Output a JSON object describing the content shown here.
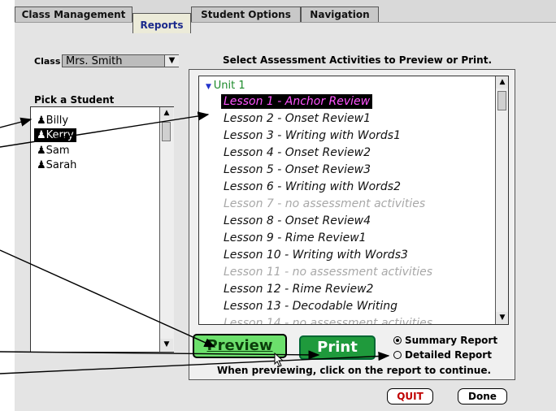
{
  "tabs": [
    {
      "label": "Class Management"
    },
    {
      "label": "Reports"
    },
    {
      "label": "Student Options"
    },
    {
      "label": "Navigation"
    }
  ],
  "class_selector": {
    "label": "Class",
    "value": "Mrs. Smith"
  },
  "student_list": {
    "heading": "Pick a Student",
    "students": [
      "Billy",
      "Kerry",
      "Sam",
      "Sarah"
    ],
    "selected": "Kerry"
  },
  "assessment": {
    "heading": "Select Assessment Activities to Preview or Print.",
    "unit_label": "Unit 1",
    "lessons": [
      {
        "label": "Lesson 1 - Anchor Review",
        "state": "selected"
      },
      {
        "label": "Lesson 2 - Onset Review1",
        "state": "normal"
      },
      {
        "label": "Lesson 3 - Writing with Words1",
        "state": "normal"
      },
      {
        "label": "Lesson 4 - Onset Review2",
        "state": "normal"
      },
      {
        "label": "Lesson 5 - Onset Review3",
        "state": "normal"
      },
      {
        "label": "Lesson 6 - Writing with Words2",
        "state": "normal"
      },
      {
        "label": "Lesson 7 - no assessment activities",
        "state": "muted"
      },
      {
        "label": "Lesson 8 - Onset Review4",
        "state": "normal"
      },
      {
        "label": "Lesson 9 - Rime Review1",
        "state": "normal"
      },
      {
        "label": "Lesson 10 - Writing with Words3",
        "state": "normal"
      },
      {
        "label": "Lesson 11 - no assessment activities",
        "state": "muted"
      },
      {
        "label": "Lesson 12 - Rime Review2",
        "state": "normal"
      },
      {
        "label": "Lesson 13 - Decodable Writing",
        "state": "normal"
      },
      {
        "label": "Lesson 14 - no assessment activities",
        "state": "muted"
      }
    ]
  },
  "actions": {
    "preview_label": "Preview",
    "print_label": "Print"
  },
  "report_type": {
    "options": [
      "Summary Report",
      "Detailed Report"
    ],
    "selected": "Summary Report"
  },
  "hint": "When previewing, click on the report to continue.",
  "footer": {
    "quit_label": "QUIT",
    "done_label": "Done"
  },
  "colors": {
    "accent_green": "#6ce06c",
    "print_green": "#1f9a3c",
    "unit_green": "#1c8a2a",
    "selected_lesson_text": "#ff55ff",
    "quit_red": "#c00000"
  }
}
